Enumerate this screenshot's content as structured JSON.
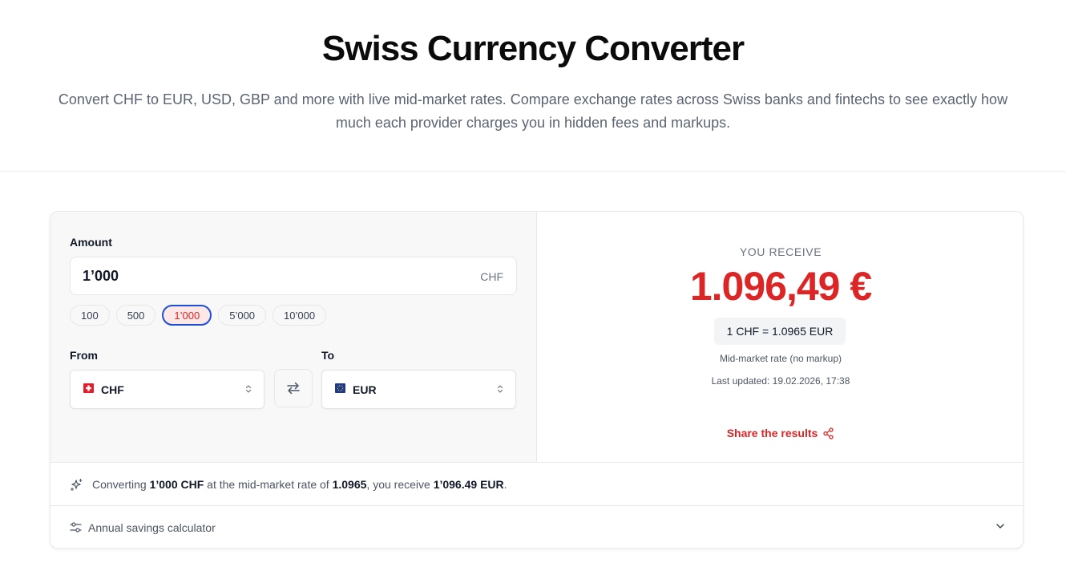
{
  "header": {
    "title": "Swiss Currency Converter",
    "subtitle": "Convert CHF to EUR, USD, GBP and more with live mid-market rates. Compare exchange rates across Swiss banks and fintechs to see exactly how much each provider charges you in hidden fees and markups."
  },
  "converter": {
    "amount_label": "Amount",
    "amount_value": "1’000",
    "amount_currency": "CHF",
    "quick_amounts": [
      "100",
      "500",
      "1’000",
      "5’000",
      "10’000"
    ],
    "selected_quick_amount": "1’000",
    "from_label": "From",
    "to_label": "To",
    "from_currency": "CHF",
    "to_currency": "EUR",
    "from_flag": "swiss-flag-icon",
    "to_flag": "eu-flag-icon"
  },
  "result": {
    "label": "YOU RECEIVE",
    "value": "1.096,49 €",
    "rate": "1 CHF = 1.0965 EUR",
    "rate_note": "Mid-market rate (no markup)",
    "last_updated": "Last updated: 19.02.2026, 17:38",
    "share_label": "Share the results"
  },
  "summary": {
    "prefix": "Converting ",
    "amount": "1’000 CHF",
    "middle": " at the mid-market rate of ",
    "rate": "1.0965",
    "middle2": ", you receive ",
    "result": "1’096.49 EUR",
    "suffix": "."
  },
  "calculator": {
    "label": "Annual savings calculator"
  },
  "colors": {
    "accent_red": "#dc2626",
    "active_chip_border": "#1d4ed8",
    "text_muted": "#5b6472"
  }
}
